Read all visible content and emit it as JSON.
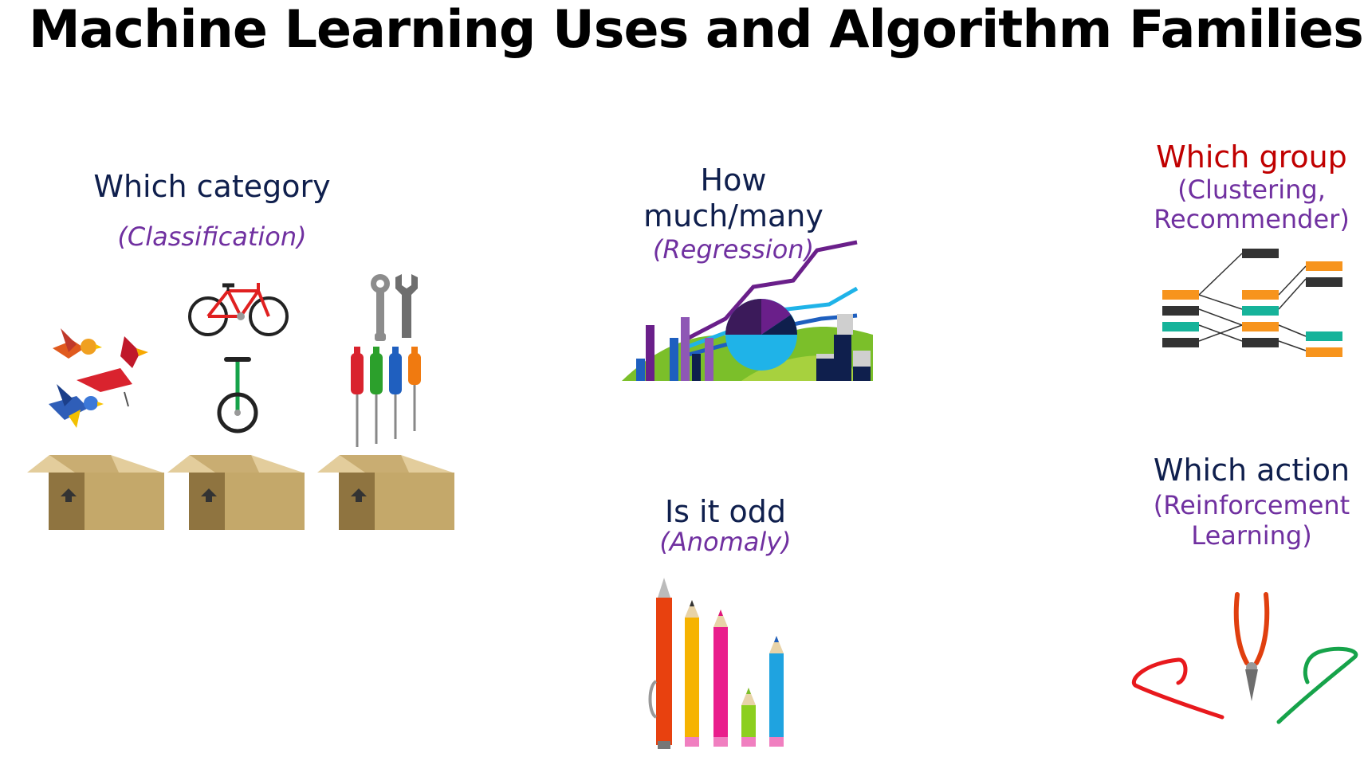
{
  "title": "Machine Learning Uses and Algorithm Families",
  "sections": {
    "classification": {
      "heading": "Which category",
      "subtitle": "(Classification)"
    },
    "regression": {
      "heading_line1": "How",
      "heading_line2": "much/many",
      "subtitle": "(Regression)"
    },
    "anomaly": {
      "heading": "Is it odd",
      "subtitle": "(Anomaly)"
    },
    "clustering": {
      "heading": "Which group",
      "subtitle_line1": "(Clustering,",
      "subtitle_line2": "Recommender)"
    },
    "reinforcement": {
      "heading": "Which action",
      "subtitle_line1": "(Reinforcement",
      "subtitle_line2": "Learning)"
    }
  },
  "colors": {
    "heading": "#0f1f4d",
    "subtitle": "#7030a0",
    "group_heading": "#c00000",
    "box": "#c4a86a"
  },
  "icons": [
    "bird-icon",
    "bicycle-icon",
    "unicycle-icon",
    "wrench-icon",
    "screwdriver-icon",
    "box-icon",
    "chart-icon",
    "pencil-icon",
    "network-icon",
    "pliers-icon",
    "wire-icon"
  ]
}
